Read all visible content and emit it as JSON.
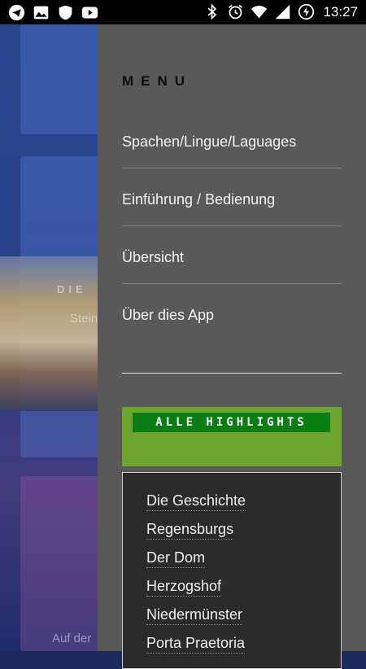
{
  "status_bar": {
    "time": "13:27",
    "left_icons": [
      "telegram-icon",
      "image-icon",
      "shield-icon",
      "youtube-icon"
    ],
    "right_icons": [
      "bluetooth-icon",
      "alarm-icon",
      "wifi-icon",
      "signal-icon",
      "battery-charging-icon"
    ]
  },
  "background": {
    "partial_text_1": "DIE",
    "partial_text_2": "Stein",
    "partial_text_3": "Auf der"
  },
  "drawer": {
    "title": "MENU",
    "items": [
      {
        "label": "Spachen/Lingue/Laguages"
      },
      {
        "label": "Einführung / Bedienung"
      },
      {
        "label": "Übersicht"
      },
      {
        "label": "Über dies App"
      }
    ],
    "highlights_label": "ALLE HIGHLIGHTS",
    "highlights_color": "#6ea52f",
    "sub_items": [
      {
        "label": "Die Geschichte"
      },
      {
        "label": "Regensburgs"
      },
      {
        "label": "Der Dom"
      },
      {
        "label": "Herzogshof"
      },
      {
        "label": "Niedermünster"
      },
      {
        "label": "Porta Praetoria"
      }
    ]
  }
}
